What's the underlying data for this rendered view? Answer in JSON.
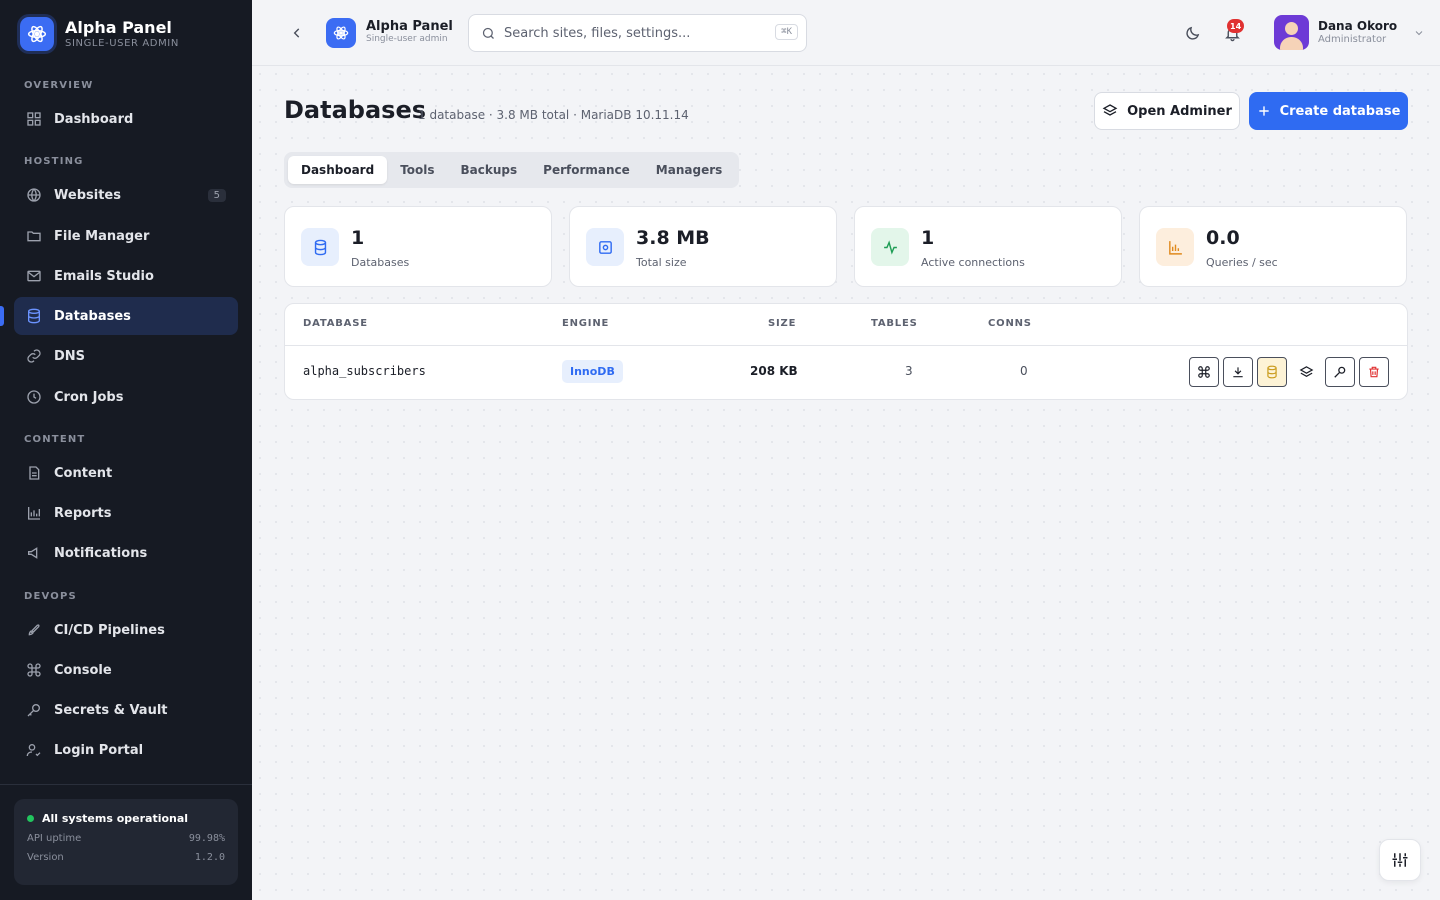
{
  "brand": {
    "name": "Alpha Panel",
    "subtitle": "SINGLE-USER ADMIN",
    "topbar_subtitle": "Single-user admin"
  },
  "sidebar": {
    "sections": [
      "OVERVIEW",
      "HOSTING",
      "CONTENT",
      "DEVOPS"
    ],
    "items": [
      {
        "label": "Dashboard",
        "icon": "grid-icon"
      },
      {
        "label": "Websites",
        "icon": "globe-icon",
        "badge": "5"
      },
      {
        "label": "File Manager",
        "icon": "folder-icon"
      },
      {
        "label": "Emails Studio",
        "icon": "mail-icon"
      },
      {
        "label": "Databases",
        "icon": "database-icon",
        "active": true
      },
      {
        "label": "DNS",
        "icon": "dns-icon"
      },
      {
        "label": "Cron Jobs",
        "icon": "clock-icon"
      },
      {
        "label": "Content",
        "icon": "document-icon"
      },
      {
        "label": "Reports",
        "icon": "bar-chart-icon"
      },
      {
        "label": "Notifications",
        "icon": "megaphone-icon"
      },
      {
        "label": "CI/CD Pipelines",
        "icon": "rocket-icon"
      },
      {
        "label": "Console",
        "icon": "command-icon"
      },
      {
        "label": "Secrets & Vault",
        "icon": "key-icon"
      },
      {
        "label": "Login Portal",
        "icon": "user-check-icon"
      }
    ],
    "status": {
      "title": "All systems operational",
      "rows": [
        {
          "label": "API uptime",
          "value": "99.98%"
        },
        {
          "label": "Version",
          "value": "1.2.0"
        }
      ]
    }
  },
  "topbar": {
    "search_placeholder": "Search sites, files, settings...",
    "shortcut": "⌘K",
    "notification_count": "14",
    "user": {
      "name": "Dana Okoro",
      "role": "Administrator"
    }
  },
  "page": {
    "title": "Databases",
    "meta": "1 database · 3.8 MB total · MariaDB 10.11.14",
    "open_adminer": "Open Adminer",
    "create_database": "Create database",
    "tabs": [
      "Dashboard",
      "Tools",
      "Backups",
      "Performance",
      "Managers"
    ],
    "active_tab": "Dashboard"
  },
  "stats": [
    {
      "value": "1",
      "label": "Databases",
      "icon": "database-icon",
      "color": "#e7effd"
    },
    {
      "value": "3.8 MB",
      "label": "Total size",
      "icon": "disk-icon",
      "color": "#e7effd"
    },
    {
      "value": "1",
      "label": "Active connections",
      "icon": "activity-icon",
      "color": "#e3f6ea"
    },
    {
      "value": "0.0",
      "label": "Queries / sec",
      "icon": "bar-chart-icon",
      "color": "#fdeedd"
    }
  ],
  "table": {
    "columns": [
      "DATABASE",
      "ENGINE",
      "SIZE",
      "TABLES",
      "CONNS"
    ],
    "rows": [
      {
        "database": "alpha_subscribers",
        "engine": "InnoDB",
        "size": "208 KB",
        "tables": "3",
        "conns": "0"
      }
    ]
  },
  "colors": {
    "accent": "#2f6bf2",
    "sidebar_bg": "#161a23",
    "success": "#22c55e",
    "danger": "#e03131"
  }
}
